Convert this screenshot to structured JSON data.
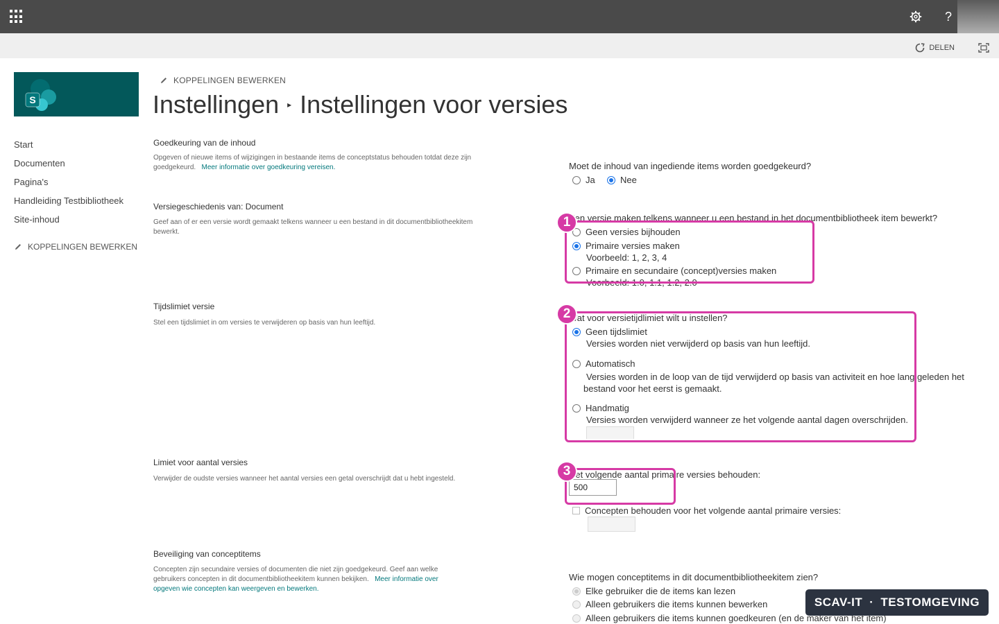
{
  "suite_bar": {
    "settings_icon": "gear-icon",
    "help_label": "?"
  },
  "command_bar": {
    "share_label": "DELEN"
  },
  "site": {
    "logo_letter": "S",
    "brand_color": "#03585a"
  },
  "top_edit_links_label": "KOPPELINGEN BEWERKEN",
  "breadcrumb": {
    "parent": "Instellingen",
    "separator": "▸",
    "current": "Instellingen voor versies"
  },
  "nav": {
    "items": [
      {
        "label": "Start"
      },
      {
        "label": "Documenten"
      },
      {
        "label": "Pagina's"
      },
      {
        "label": "Handleiding Testbibliotheek"
      },
      {
        "label": "Site-inhoud"
      }
    ],
    "edit_links_label": "KOPPELINGEN BEWERKEN"
  },
  "sections": {
    "approval": {
      "title": "Goedkeuring van de inhoud",
      "desc": "Opgeven of nieuwe items of wijzigingen in bestaande items de conceptstatus behouden totdat deze zijn goedgekeurd.",
      "link": "Meer informatie over goedkeuring vereisen.",
      "question": "Moet de inhoud van ingediende items worden goedgekeurd?",
      "options": [
        "Ja",
        "Nee"
      ],
      "selected": "Nee"
    },
    "history": {
      "title": "Versiegeschiedenis van: Document",
      "desc": "Geef aan of er een versie wordt gemaakt telkens wanneer u een bestand in dit documentbibliotheekitem bewerkt.",
      "question": "Een versie maken telkens wanneer u een bestand in het documentbibliotheek item bewerkt?",
      "options": [
        {
          "label": "Geen versies bijhouden",
          "example": ""
        },
        {
          "label": "Primaire versies maken",
          "example": "Voorbeeld: 1, 2, 3, 4"
        },
        {
          "label": "Primaire en secundaire (concept)versies maken",
          "example": "Voorbeeld: 1.0, 1.1, 1.2, 2.0"
        }
      ],
      "selected": "Primaire versies maken"
    },
    "time_limit": {
      "title": "Tijdslimiet versie",
      "desc": "Stel een tijdslimiet in om versies te verwijderen op basis van hun leeftijd.",
      "question": "Wat voor versietijdlimiet wilt u instellen?",
      "options": [
        {
          "label": "Geen tijdslimiet",
          "desc": "Versies worden niet verwijderd op basis van hun leeftijd."
        },
        {
          "label": "Automatisch",
          "desc": "Versies worden in de loop van de tijd verwijderd op basis van activiteit en hoe lang geleden het bestand voor het eerst is gemaakt."
        },
        {
          "label": "Handmatig",
          "desc": "Versies worden verwijderd wanneer ze het volgende aantal dagen overschrijden."
        }
      ],
      "selected": "Geen tijdslimiet"
    },
    "count_limit": {
      "title": "Limiet voor aantal versies",
      "desc": "Verwijder de oudste versies wanneer het aantal versies een getal overschrijdt dat u hebt ingesteld.",
      "question": "Het volgende aantal primaire versies behouden:",
      "value": "500",
      "drafts_label": "Concepten behouden voor het volgende aantal primaire versies:"
    },
    "draft_security": {
      "title": "Beveiliging van conceptitems",
      "desc": "Concepten zijn secundaire versies of documenten die niet zijn goedgekeurd. Geef aan welke gebruikers concepten in dit documentbibliotheekitem kunnen bekijken.",
      "link": "Meer informatie over opgeven wie concepten kan weergeven en bewerken.",
      "question": "Wie mogen conceptitems in dit documentbibliotheekitem zien?",
      "options": [
        "Elke gebruiker die de items kan lezen",
        "Alleen gebruikers die items kunnen bewerken",
        "Alleen gebruikers die items kunnen goedkeuren (en de maker van het item)"
      ]
    }
  },
  "annotations": {
    "badges": [
      "1",
      "2",
      "3"
    ],
    "color": "#d63aa5"
  },
  "environment_badge": {
    "left": "SCAV-IT",
    "dot": "·",
    "right": "TESTOMGEVING"
  }
}
